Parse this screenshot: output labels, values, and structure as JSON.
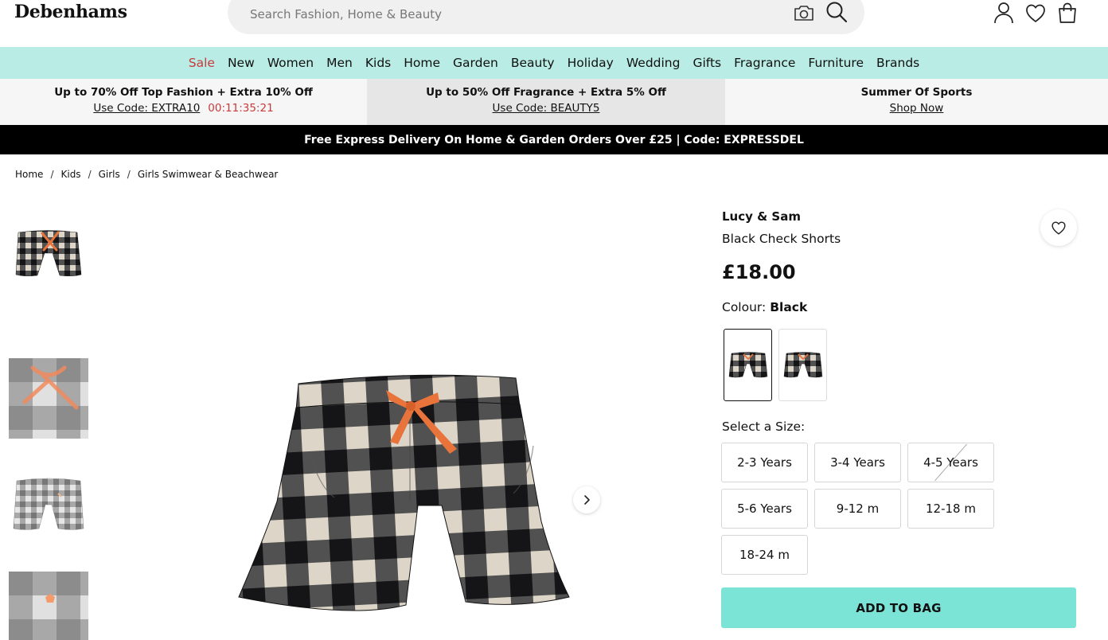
{
  "header": {
    "logo": "Debenhams",
    "search_placeholder": "Search Fashion, Home & Beauty",
    "icons": [
      "camera-icon",
      "search-icon",
      "account-icon",
      "heart-icon",
      "bag-icon"
    ]
  },
  "nav": {
    "items": [
      "Sale",
      "New",
      "Women",
      "Men",
      "Kids",
      "Home",
      "Garden",
      "Beauty",
      "Holiday",
      "Wedding",
      "Gifts",
      "Fragrance",
      "Furniture",
      "Brands"
    ],
    "sale_color": "#c93a3a",
    "background": "#b8ece4"
  },
  "promos": [
    {
      "title": "Up to 70% Off Top Fashion + Extra 10% Off",
      "link": "Use Code: EXTRA10",
      "timer": "00:11:35:21"
    },
    {
      "title": "Up to 50% Off Fragrance + Extra 5% Off",
      "link": "Use Code: BEAUTY5"
    },
    {
      "title": "Summer Of Sports",
      "link": "Shop Now"
    }
  ],
  "delivery_banner": "Free Express Delivery On Home & Garden Orders Over £25 | Code: EXPRESSDEL",
  "breadcrumb": [
    "Home",
    "Kids",
    "Girls",
    "Girls Swimwear & Beachwear"
  ],
  "product": {
    "brand": "Lucy & Sam",
    "name": "Black Check Shorts",
    "price": "£18.00",
    "colour_label": "Colour:",
    "colour_value": "Black",
    "size_label": "Select a Size:",
    "sizes": [
      {
        "label": "2-3 Years",
        "available": true
      },
      {
        "label": "3-4 Years",
        "available": true
      },
      {
        "label": "4-5 Years",
        "available": false
      },
      {
        "label": "5-6 Years",
        "available": true
      },
      {
        "label": "9-12 m",
        "available": true
      },
      {
        "label": "12-18 m",
        "available": true
      },
      {
        "label": "18-24 m",
        "available": true
      }
    ],
    "add_to_bag": "ADD TO BAG",
    "button_color": "#7ce4d6"
  }
}
